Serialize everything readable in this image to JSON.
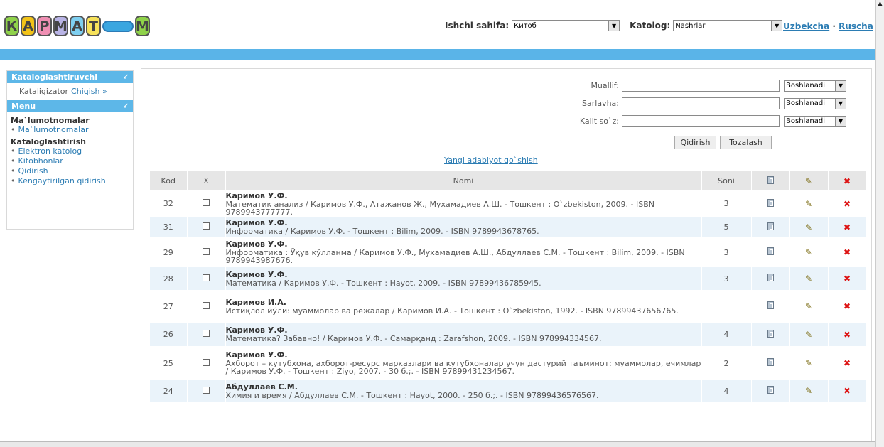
{
  "logo": {
    "letters": [
      "К",
      "А",
      "Р",
      "М",
      "А",
      "Т",
      "М"
    ],
    "colors": [
      "#8fd24a",
      "#f2c318",
      "#ef8fb3",
      "#b9b4e6",
      "#7ecff0",
      "#f7e25a",
      "#8fd24a"
    ]
  },
  "header": {
    "ishchi_label": "Ishchi sahifa:",
    "ishchi_value": "Китоб",
    "katolog_label": "Katolog:",
    "katolog_value": "Nashrlar",
    "lang_uz": "Uzbekcha",
    "lang_sep": "·",
    "lang_ru": "Ruscha"
  },
  "sidebar": {
    "section1_title": "Kataloglashtiruvchi",
    "katalog_user": "Kataligizator",
    "logout": "Chiqish »",
    "section2_title": "Menu",
    "group1": "Ma`lumotnomalar",
    "group1_items": [
      "Ma`lumotnomalar"
    ],
    "group2": "Kataloglashtirish",
    "group2_items": [
      "Elektron katolog",
      "Kitobhonlar",
      "Qidirish",
      "Kengaytirilgan qidirish"
    ]
  },
  "search": {
    "muallif_label": "Muallif:",
    "sarlavha_label": "Sarlavha:",
    "kalit_label": "Kalit so`z:",
    "mode": "Boshlanadi",
    "qidirish": "Qidirish",
    "tozalash": "Tozalash",
    "new_link": "Yangi adabiyot qo`shish"
  },
  "table": {
    "headers": {
      "kod": "Kod",
      "x": "X",
      "nomi": "Nomi",
      "soni": "Soni"
    },
    "rows": [
      {
        "kod": "32",
        "author": "Каримов У.Ф.",
        "desc": "Математик анализ / Каримов У.Ф., Атажанов Ж., Мухамадиев А.Ш. - Тошкент : O`zbekiston, 2009. - ISBN 9789943777777.",
        "soni": "3"
      },
      {
        "kod": "31",
        "author": "Каримов У.Ф.",
        "desc": "Информатика / Каримов У.Ф. - Тошкент : Bilim, 2009. - ISBN 9789943678765.",
        "soni": "5"
      },
      {
        "kod": "29",
        "author": "Каримов У.Ф.",
        "desc": "Информатика : Ўқув қўлланма / Каримов У.Ф., Мухамадиев А.Ш., Абдуллаев С.М. - Тошкент : Bilim, 2009. - ISBN 9789943987676.",
        "soni": "3"
      },
      {
        "kod": "28",
        "author": "Каримов У.Ф.",
        "desc": "Математика / Каримов У.Ф. - Тошкент : Hayot, 2009. - ISBN 97899436785945.",
        "soni": "3"
      },
      {
        "kod": "27",
        "author": "Каримов И.А.",
        "desc": "Истиқлол йўли: муаммолар ва режалар / Каримов И.А. - Тошкент : O`zbekiston, 1992. - ISBN 97899437656765.",
        "soni": ""
      },
      {
        "kod": "26",
        "author": "Каримов У.Ф.",
        "desc": "Математика? Забавно! / Каримов У.Ф. - Самарқанд : Zarafshon, 2009. - ISBN 978994334567.",
        "soni": "4"
      },
      {
        "kod": "25",
        "author": "Каримов У.Ф.",
        "desc": "Ахборот – кутубхона, ахборот-ресурс марказлари ва кутубхоналар учун дастурий таъминот: муаммолар, ечимлар / Каримов У.Ф. - Тошкент : Ziyo, 2007. - 30 б.;. - ISBN 97899431234567.",
        "soni": "2"
      },
      {
        "kod": "24",
        "author": "Абдуллаев С.М.",
        "desc": "Химия и время / Абдуллаев С.М. - Тошкент : Hayot, 2000. - 250 б.;. - ISBN 97899436576567.",
        "soni": "4"
      }
    ]
  }
}
